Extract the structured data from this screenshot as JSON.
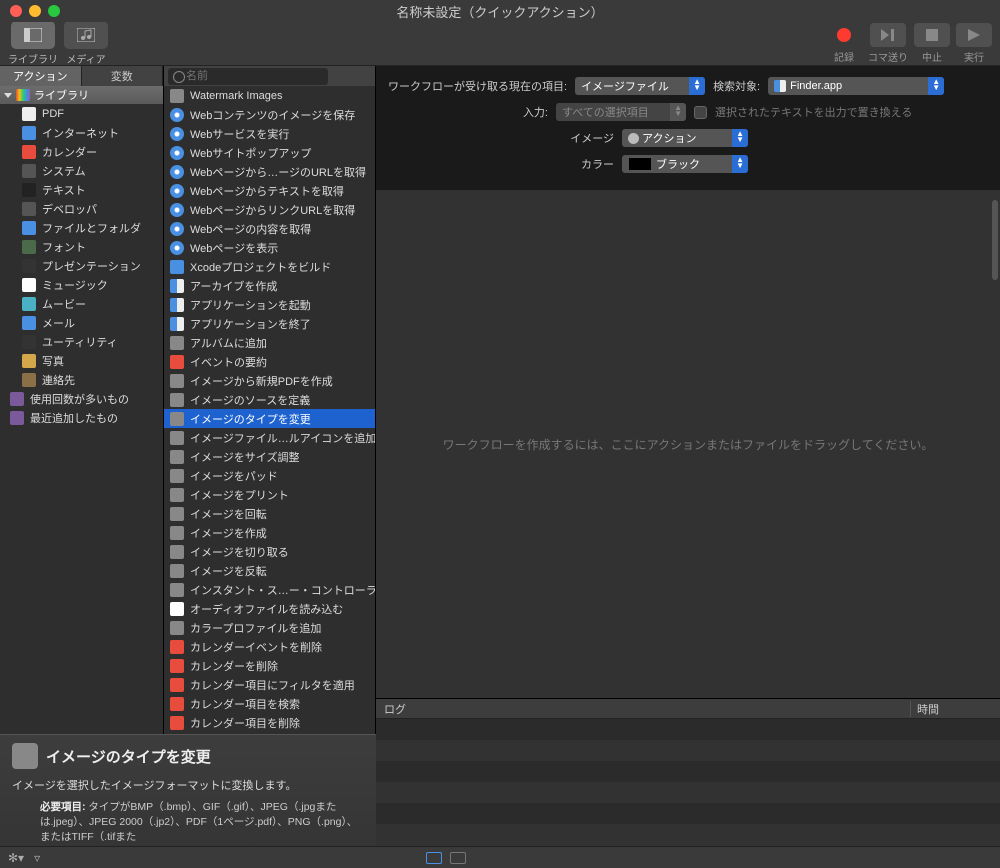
{
  "window": {
    "title": "名称未設定（クイックアクション）"
  },
  "toolbar": {
    "library_label": "ライブラリ",
    "media_label": "メディア",
    "record_label": "記録",
    "step_label": "コマ送り",
    "stop_label": "中止",
    "run_label": "実行"
  },
  "sidebar": {
    "tabs": {
      "action": "アクション",
      "variable": "変数"
    },
    "library_header": "ライブラリ",
    "items": [
      "PDF",
      "インターネット",
      "カレンダー",
      "システム",
      "テキスト",
      "デベロッパ",
      "ファイルとフォルダ",
      "フォント",
      "プレゼンテーション",
      "ミュージック",
      "ムービー",
      "メール",
      "ユーティリティ",
      "写真",
      "連絡先"
    ],
    "smart": [
      "使用回数が多いもの",
      "最近追加したもの"
    ]
  },
  "search": {
    "placeholder": "名前"
  },
  "actions": [
    {
      "label": "Watermark Images",
      "icon": "image"
    },
    {
      "label": "Webコンテンツのイメージを保存",
      "icon": "safari"
    },
    {
      "label": "Webサービスを実行",
      "icon": "safari"
    },
    {
      "label": "Webサイトポップアップ",
      "icon": "safari"
    },
    {
      "label": "Webページから…ージのURLを取得",
      "icon": "safari"
    },
    {
      "label": "Webページからテキストを取得",
      "icon": "safari"
    },
    {
      "label": "WebページからリンクURLを取得",
      "icon": "safari"
    },
    {
      "label": "Webページの内容を取得",
      "icon": "safari"
    },
    {
      "label": "Webページを表示",
      "icon": "safari"
    },
    {
      "label": "Xcodeプロジェクトをビルド",
      "icon": "xcode"
    },
    {
      "label": "アーカイブを作成",
      "icon": "finder"
    },
    {
      "label": "アプリケーションを起動",
      "icon": "finder"
    },
    {
      "label": "アプリケーションを終了",
      "icon": "finder"
    },
    {
      "label": "アルバムに追加",
      "icon": "image"
    },
    {
      "label": "イベントの要約",
      "icon": "calendar"
    },
    {
      "label": "イメージから新規PDFを作成",
      "icon": "image"
    },
    {
      "label": "イメージのソースを定義",
      "icon": "image"
    },
    {
      "label": "イメージのタイプを変更",
      "icon": "image",
      "selected": true
    },
    {
      "label": "イメージファイル…ルアイコンを追加",
      "icon": "image"
    },
    {
      "label": "イメージをサイズ調整",
      "icon": "image"
    },
    {
      "label": "イメージをパッド",
      "icon": "image"
    },
    {
      "label": "イメージをプリント",
      "icon": "image"
    },
    {
      "label": "イメージを回転",
      "icon": "image"
    },
    {
      "label": "イメージを作成",
      "icon": "image"
    },
    {
      "label": "イメージを切り取る",
      "icon": "image"
    },
    {
      "label": "イメージを反転",
      "icon": "image"
    },
    {
      "label": "インスタント・ス…ー・コントローラ",
      "icon": "image"
    },
    {
      "label": "オーディオファイルを読み込む",
      "icon": "music"
    },
    {
      "label": "カラープロファイルを追加",
      "icon": "image"
    },
    {
      "label": "カレンダーイベントを削除",
      "icon": "calendar"
    },
    {
      "label": "カレンダーを削除",
      "icon": "calendar"
    },
    {
      "label": "カレンダー項目にフィルタを適用",
      "icon": "calendar"
    },
    {
      "label": "カレンダー項目を検索",
      "icon": "calendar"
    },
    {
      "label": "カレンダー項目を削除",
      "icon": "calendar"
    }
  ],
  "workflow": {
    "receives_label": "ワークフローが受け取る現在の項目:",
    "receives_value": "イメージファイル",
    "search_target_label": "検索対象:",
    "search_target_value": "Finder.app",
    "input_label": "入力:",
    "input_value": "すべての選択項目",
    "output_checkbox_label": "選択されたテキストを出力で置き換える",
    "image_label": "イメージ",
    "image_value": "アクション",
    "color_label": "カラー",
    "color_value": "ブラック",
    "placeholder_text": "ワークフローを作成するには、ここにアクションまたはファイルをドラッグしてください。"
  },
  "log": {
    "col_log": "ログ",
    "col_time": "時間"
  },
  "description": {
    "title": "イメージのタイプを変更",
    "body": "イメージを選択したイメージフォーマットに変換します。",
    "req_label": "必要項目:",
    "req_text": "タイプがBMP（.bmp）、GIF（.gif）、JPEG（.jpgまたは.jpeg）、JPEG 2000（.jp2）、PDF（1ページ.pdf）、PNG（.png）、またはTIFF（.tifまた"
  }
}
